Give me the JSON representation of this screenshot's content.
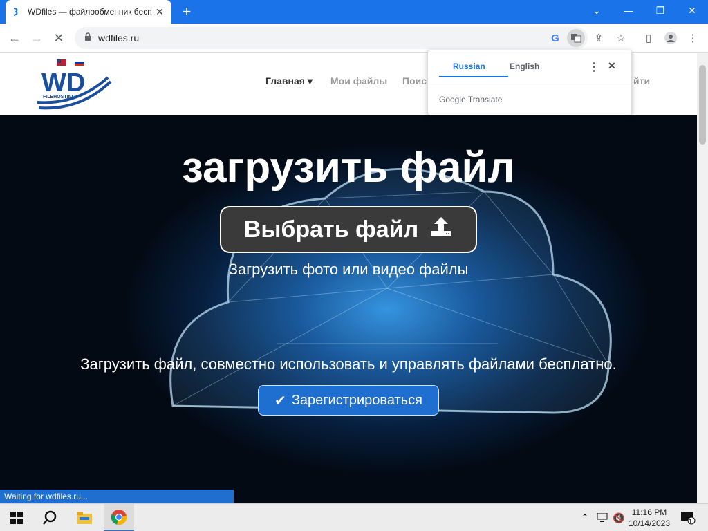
{
  "browser": {
    "tab_title": "WDfiles — файлообменник бесплатный",
    "url": "wdfiles.ru",
    "status_text": "Waiting for wdfiles.ru..."
  },
  "translate_popup": {
    "lang_source": "Russian",
    "lang_target": "English",
    "brand": "Google Translate"
  },
  "site": {
    "logo_text": "WD",
    "logo_subtext": "FILEHOSTING",
    "nav": {
      "home": "Главная",
      "my_files": "Мои файлы",
      "search": "Поиск",
      "login": "йти"
    }
  },
  "hero": {
    "title": "загрузить файл",
    "choose_button": "Выбрать файл",
    "subtitle": "Загрузить фото или видео файлы",
    "description": "Загрузить файл, совместно использовать и управлять файлами бесплатно.",
    "register_button": "Зарегистрироваться"
  },
  "taskbar": {
    "time": "11:16 PM",
    "date": "10/14/2023",
    "notification_count": "1"
  },
  "colors": {
    "chrome_blue": "#1a73e8",
    "hero_dark": "#030a14",
    "button_blue": "#1f6fd0"
  }
}
